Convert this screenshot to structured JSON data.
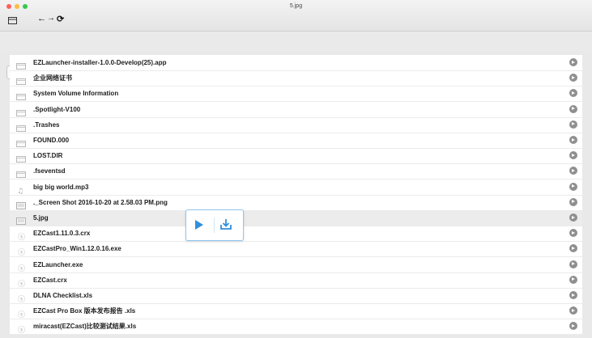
{
  "window": {
    "title": "5.jpg"
  },
  "toolbar": {
    "back_symbol": "←",
    "forward_symbol": "→",
    "reload_symbol": "⟳",
    "up_symbol": "⊃"
  },
  "files": [
    {
      "name": "EZLauncher-installer-1.0.0-Develop(25).app",
      "icon": "folder-icon",
      "selected": false
    },
    {
      "name": "企业网络证书",
      "icon": "folder-icon",
      "selected": false
    },
    {
      "name": "System Volume Information",
      "icon": "folder-icon",
      "selected": false
    },
    {
      "name": ".Spotlight-V100",
      "icon": "folder-icon",
      "selected": false
    },
    {
      "name": ".Trashes",
      "icon": "folder-icon",
      "selected": false
    },
    {
      "name": "FOUND.000",
      "icon": "folder-icon",
      "selected": false
    },
    {
      "name": "LOST.DIR",
      "icon": "folder-icon",
      "selected": false
    },
    {
      "name": ".fseventsd",
      "icon": "folder-icon",
      "selected": false
    },
    {
      "name": "big big world.mp3",
      "icon": "music-file-icon",
      "selected": false
    },
    {
      "name": "._Screen Shot 2016-10-20 at 2.58.03 PM.png",
      "icon": "image-file-icon",
      "selected": false
    },
    {
      "name": "5.jpg",
      "icon": "image-file-icon",
      "selected": true
    },
    {
      "name": "EZCast1.11.0.3.crx",
      "icon": "document-file-icon",
      "selected": false
    },
    {
      "name": "EZCastPro_Win1.12.0.16.exe",
      "icon": "document-file-icon",
      "selected": false
    },
    {
      "name": "EZLauncher.exe",
      "icon": "document-file-icon",
      "selected": false
    },
    {
      "name": "EZCast.crx",
      "icon": "document-file-icon",
      "selected": false
    },
    {
      "name": "DLNA Checklist.xls",
      "icon": "document-file-icon",
      "selected": false
    },
    {
      "name": "EZCast Pro Box 版本发布报告 .xls",
      "icon": "document-file-icon",
      "selected": false
    },
    {
      "name": "miracast(EZCast)比较测试结果.xls",
      "icon": "document-file-icon",
      "selected": false
    }
  ],
  "popup": {
    "actions": [
      "play-icon",
      "download-icon"
    ]
  },
  "colors": {
    "accent": "#2f8fdc",
    "row_selected": "#ececec",
    "chevron": "#8f8f8f"
  }
}
